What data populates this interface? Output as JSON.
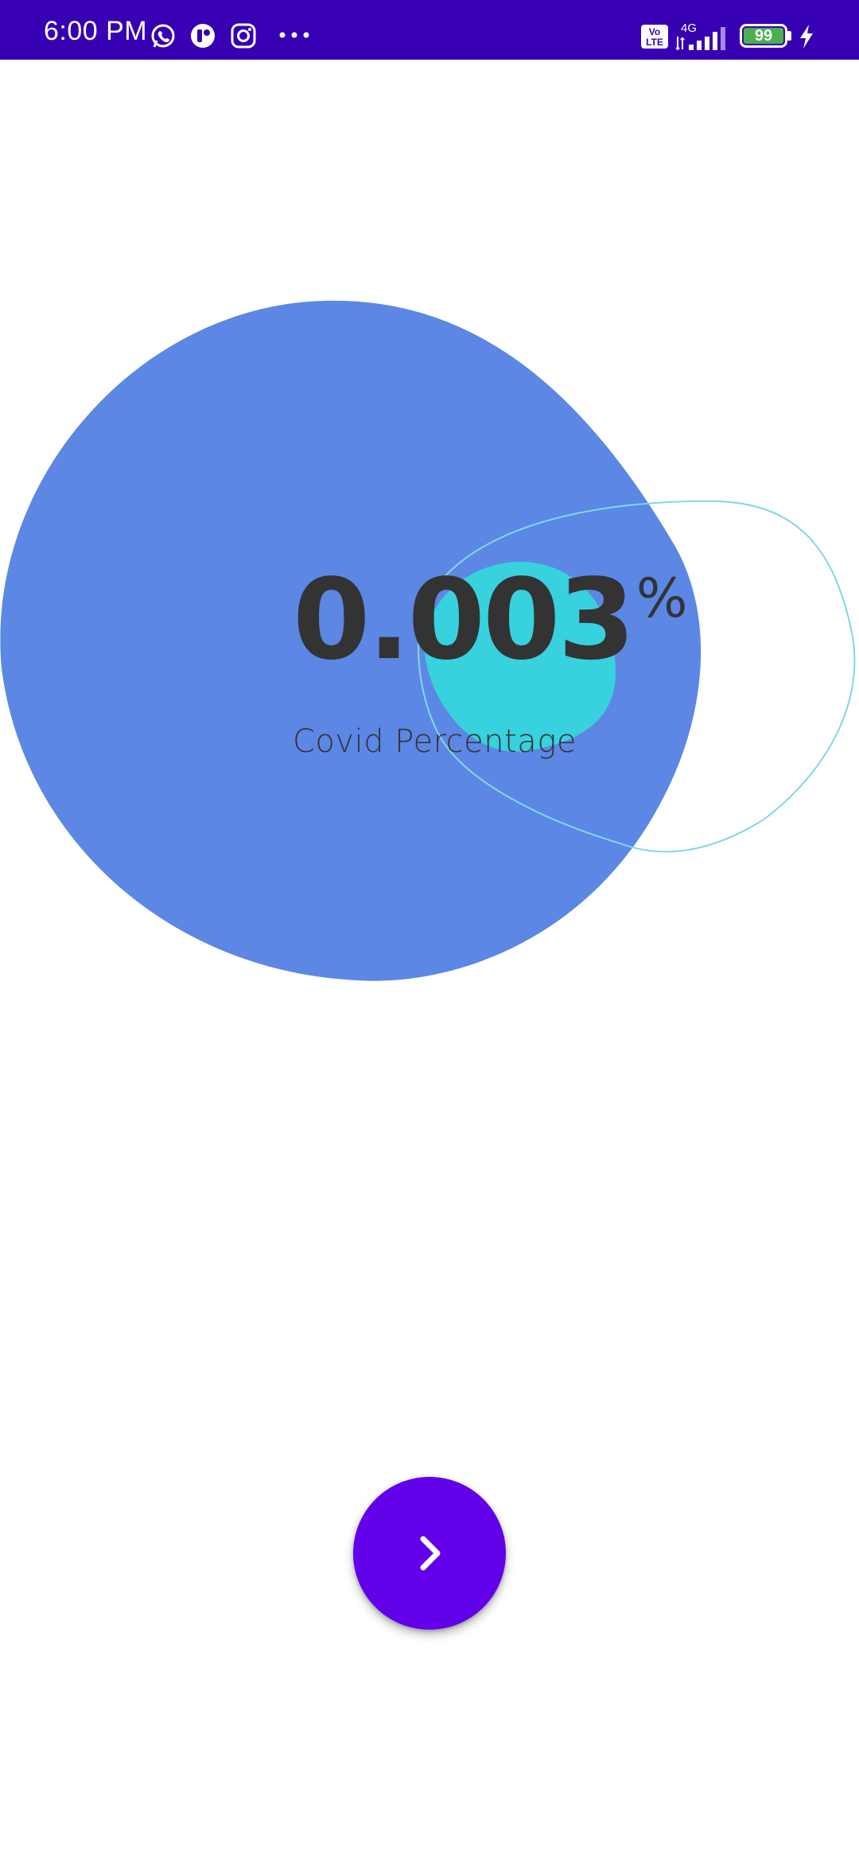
{
  "status_bar": {
    "time": "6:00 PM",
    "network_type": "4G",
    "volte_top": "Vo",
    "volte_bottom": "LTE",
    "battery_level": "99",
    "icons": [
      "whatsapp-icon",
      "notification-app-icon",
      "instagram-icon",
      "more-dots-icon",
      "volte-icon",
      "signal-icon",
      "battery-icon",
      "charging-icon"
    ],
    "colors": {
      "background": "#3700b3",
      "battery_fill": "#4caf50"
    }
  },
  "stat": {
    "value": "0.003",
    "unit": "%",
    "label": "Covid Percentage"
  },
  "next_button": {
    "icon": "chevron-right-icon",
    "color": "#6200ea"
  },
  "decoration": {
    "large_blob_color": "#5c87e4",
    "small_blob_color": "#38d1de",
    "outline_blob_color": "#7fd8e6"
  }
}
